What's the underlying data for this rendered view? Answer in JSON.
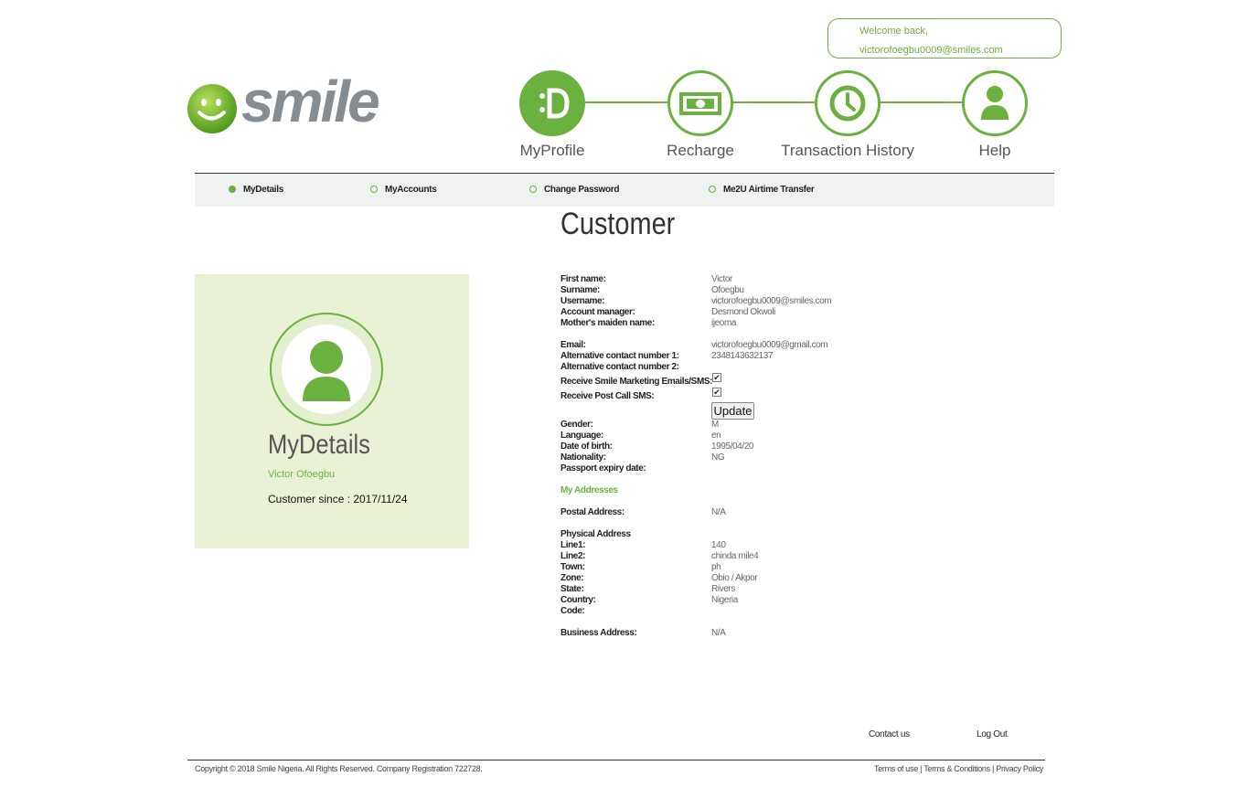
{
  "header": {
    "welcome_text": "Welcome back,",
    "user_email": "victorofoegbu0009@smiles.com",
    "logo_text": "smile",
    "brand_color": "#6bb140"
  },
  "nav": [
    {
      "label": "MyProfile",
      "icon": "profile-smile-icon",
      "active": true
    },
    {
      "label": "Recharge",
      "icon": "banknote-icon",
      "active": false
    },
    {
      "label": "Transaction History",
      "icon": "clock-icon",
      "active": false
    },
    {
      "label": "Help",
      "icon": "person-icon",
      "active": false
    }
  ],
  "subnav": [
    {
      "label": "MyDetails",
      "active": true
    },
    {
      "label": "MyAccounts",
      "active": false
    },
    {
      "label": "Change Password",
      "active": false
    },
    {
      "label": "Me2U Airtime Transfer",
      "active": false
    }
  ],
  "page_title": "Customer",
  "card": {
    "title": "MyDetails",
    "name": "Victor Ofoegbu",
    "since": "Customer since : 2017/11/24"
  },
  "details": {
    "first_name": {
      "label": "First name:",
      "value": "Victor"
    },
    "surname": {
      "label": "Surname:",
      "value": "Ofoegbu"
    },
    "username": {
      "label": "Username:",
      "value": "victorofoegbu0009@smiles.com"
    },
    "account_manager": {
      "label": "Account manager:",
      "value": "Desmond Okwoli"
    },
    "maiden_name": {
      "label": "Mother's maiden name:",
      "value": "ijeoma"
    },
    "email": {
      "label": "Email:",
      "value": "victorofoegbu0009@gmail.com"
    },
    "alt_contact_1": {
      "label": "Alternative contact number 1:",
      "value": "2348143632137"
    },
    "alt_contact_2": {
      "label": "Alternative contact number 2:",
      "value": ""
    },
    "marketing": {
      "label": "Receive Smile Marketing Emails/SMS:",
      "checked": true
    },
    "post_call": {
      "label": "Receive Post Call SMS:",
      "checked": true
    },
    "update_label": "Update",
    "gender": {
      "label": "Gender:",
      "value": "M"
    },
    "language": {
      "label": "Language:",
      "value": "en"
    },
    "dob": {
      "label": "Date of birth:",
      "value": "1995/04/20"
    },
    "nationality": {
      "label": "Nationality:",
      "value": "NG"
    },
    "passport": {
      "label": "Passport expiry date:",
      "value": ""
    }
  },
  "addresses": {
    "title": "My Addresses",
    "postal": {
      "label": "Postal Address:",
      "value": "N/A"
    },
    "physical_title": "Physical Address",
    "line1": {
      "label": "Line1:",
      "value": "140"
    },
    "line2": {
      "label": "Line2:",
      "value": "chinda mile4"
    },
    "town": {
      "label": "Town:",
      "value": "ph"
    },
    "zone": {
      "label": "Zone:",
      "value": "Obio / Akpor"
    },
    "state": {
      "label": "State:",
      "value": "Rivers"
    },
    "country": {
      "label": "Country:",
      "value": "Nigeria"
    },
    "code": {
      "label": "Code:",
      "value": ""
    },
    "business": {
      "label": "Business Address:",
      "value": "N/A"
    }
  },
  "footer": {
    "contact": "Contact us",
    "logout": "Log Out",
    "copyright": "Copyright © 2018 Smile Nigeria. All Rights Reserved. Company Registration 722728.",
    "terms_use": "Terms of use",
    "terms_conditions": "Terms & Conditions",
    "privacy": "Privacy Policy",
    "sep": " | "
  }
}
